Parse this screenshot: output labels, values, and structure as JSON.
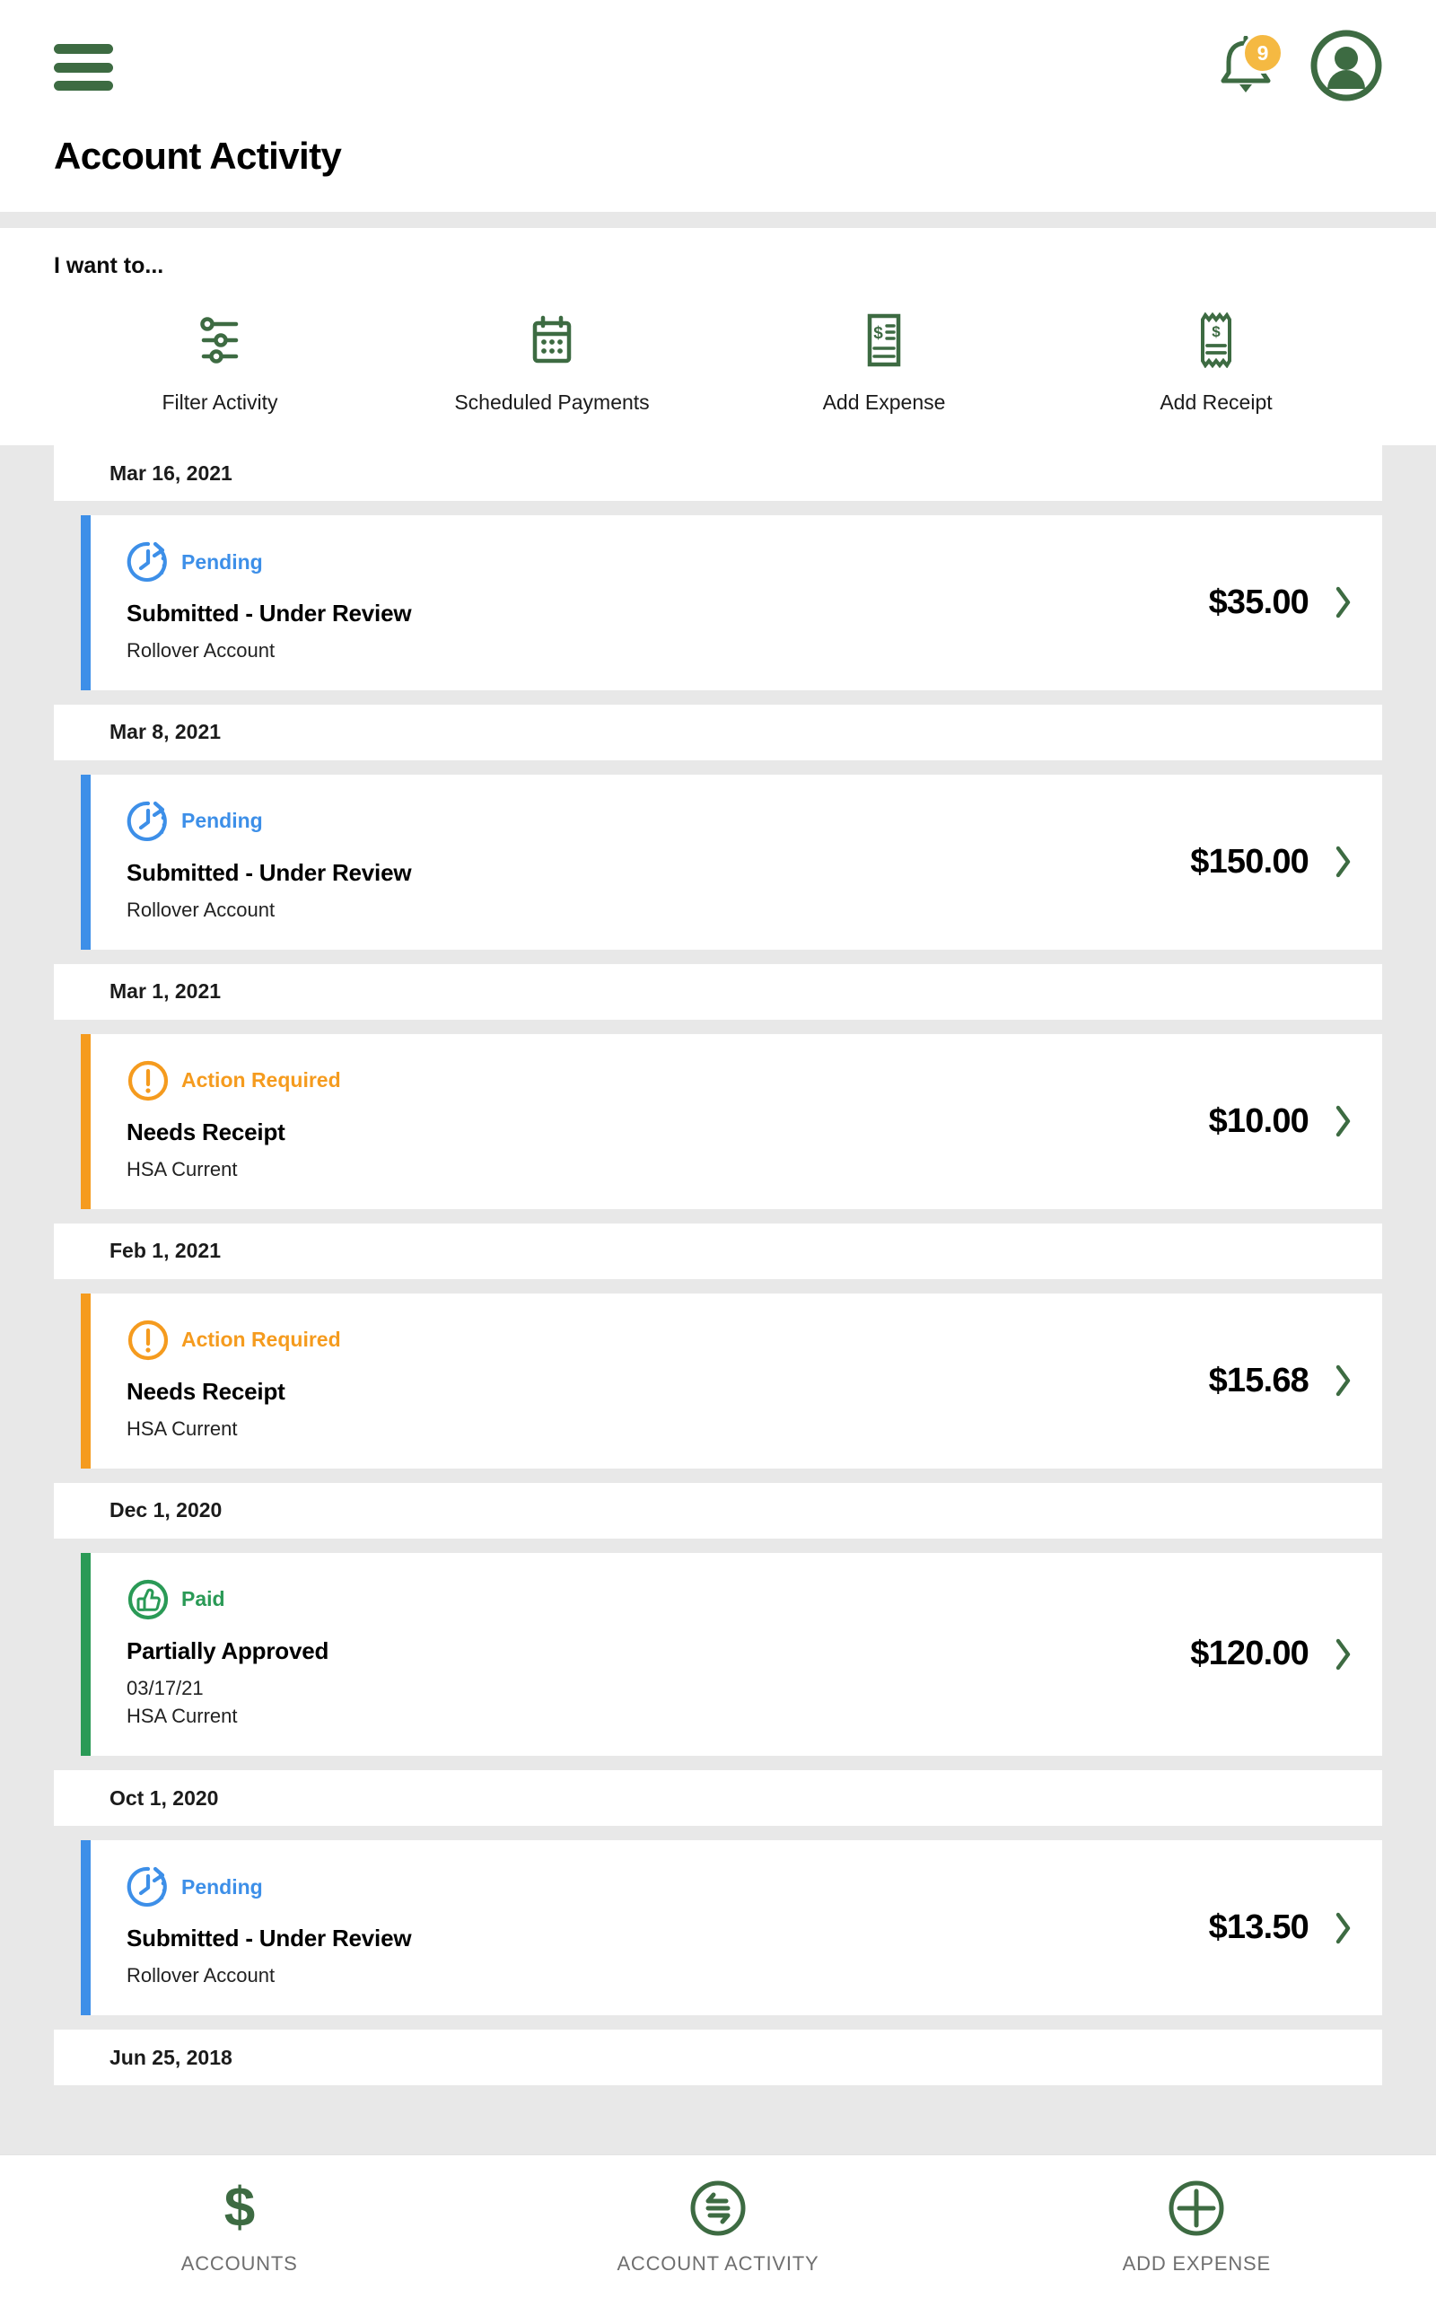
{
  "theme": {
    "brand_green": "#3d6b42",
    "pending_blue": "#3d8fe8",
    "action_orange": "#f59b1e",
    "paid_green": "#2a9a56",
    "badge_amber": "#f5b942",
    "page_bg": "#e8e8e8"
  },
  "header": {
    "menu_icon": "hamburger-icon",
    "notification_icon": "bell-icon",
    "notification_count": "9",
    "profile_icon": "user-avatar-icon",
    "title": "Account Activity"
  },
  "quick_actions": {
    "label": "I want to...",
    "items": [
      {
        "label": "Filter Activity",
        "icon": "sliders-icon"
      },
      {
        "label": "Scheduled Payments",
        "icon": "calendar-icon"
      },
      {
        "label": "Add Expense",
        "icon": "invoice-dollar-icon"
      },
      {
        "label": "Add Receipt",
        "icon": "receipt-dollar-icon"
      }
    ]
  },
  "activity": {
    "groups": [
      {
        "date": "Mar 16, 2021",
        "transaction": {
          "status": "Pending",
          "status_icon": "clock-pending-icon",
          "accent": "#3d8fe8",
          "status_color": "#3d8fe8",
          "title": "Submitted - Under Review",
          "detail": "",
          "account": "Rollover Account",
          "amount": "$35.00",
          "chevron": "chevron-right-icon"
        }
      },
      {
        "date": "Mar 8, 2021",
        "transaction": {
          "status": "Pending",
          "status_icon": "clock-pending-icon",
          "accent": "#3d8fe8",
          "status_color": "#3d8fe8",
          "title": "Submitted - Under Review",
          "detail": "",
          "account": "Rollover Account",
          "amount": "$150.00",
          "chevron": "chevron-right-icon"
        }
      },
      {
        "date": "Mar 1, 2021",
        "transaction": {
          "status": "Action Required",
          "status_icon": "exclamation-circle-icon",
          "accent": "#f59b1e",
          "status_color": "#f59b1e",
          "title": "Needs Receipt",
          "detail": "",
          "account": "HSA Current",
          "amount": "$10.00",
          "chevron": "chevron-right-icon"
        }
      },
      {
        "date": "Feb 1, 2021",
        "transaction": {
          "status": "Action Required",
          "status_icon": "exclamation-circle-icon",
          "accent": "#f59b1e",
          "status_color": "#f59b1e",
          "title": "Needs Receipt",
          "detail": "",
          "account": "HSA Current",
          "amount": "$15.68",
          "chevron": "chevron-right-icon"
        }
      },
      {
        "date": "Dec 1, 2020",
        "transaction": {
          "status": "Paid",
          "status_icon": "thumbs-up-circle-icon",
          "accent": "#2a9a56",
          "status_color": "#2a9a56",
          "title": "Partially Approved",
          "detail": "03/17/21",
          "account": "HSA Current",
          "amount": "$120.00",
          "chevron": "chevron-right-icon"
        }
      },
      {
        "date": "Oct 1, 2020",
        "transaction": {
          "status": "Pending",
          "status_icon": "clock-pending-icon",
          "accent": "#3d8fe8",
          "status_color": "#3d8fe8",
          "title": "Submitted - Under Review",
          "detail": "",
          "account": "Rollover Account",
          "amount": "$13.50",
          "chevron": "chevron-right-icon"
        }
      },
      {
        "date": "Jun 25, 2018",
        "transaction": null
      }
    ]
  },
  "bottom_nav": {
    "items": [
      {
        "label": "ACCOUNTS",
        "icon": "dollar-sign-icon"
      },
      {
        "label": "ACCOUNT ACTIVITY",
        "icon": "transfer-circle-icon"
      },
      {
        "label": "ADD EXPENSE",
        "icon": "plus-circle-icon"
      }
    ]
  }
}
